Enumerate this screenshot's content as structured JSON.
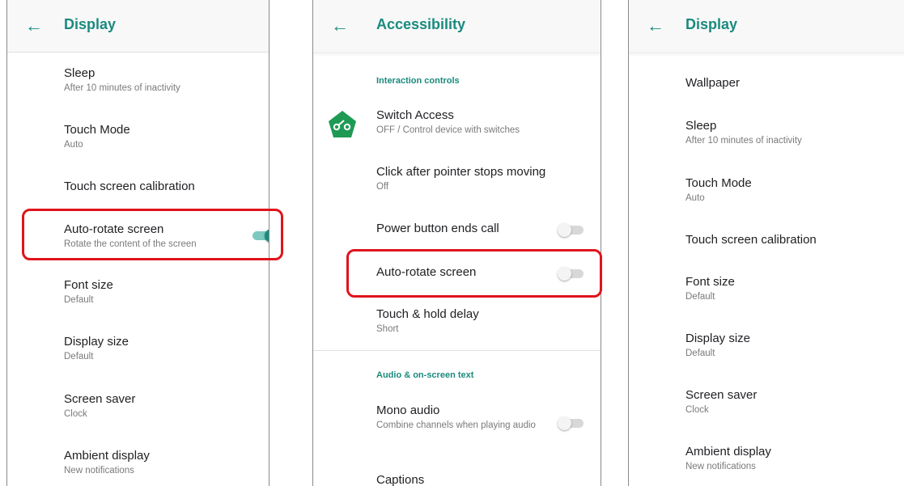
{
  "screens": [
    {
      "title": "Display",
      "items": [
        {
          "title": "Sleep",
          "summary": "After 10 minutes of inactivity"
        },
        {
          "title": "Touch Mode",
          "summary": "Auto"
        },
        {
          "title": "Touch screen calibration",
          "summary": ""
        },
        {
          "title": "Auto-rotate screen",
          "summary": "Rotate the content of the screen",
          "toggle": "on"
        },
        {
          "title": "Font size",
          "summary": "Default"
        },
        {
          "title": "Display size",
          "summary": "Default"
        },
        {
          "title": "Screen saver",
          "summary": "Clock"
        },
        {
          "title": "Ambient display",
          "summary": "New notifications"
        }
      ]
    },
    {
      "title": "Accessibility",
      "section1": "Interaction controls",
      "section2": "Audio & on-screen text",
      "items": [
        {
          "title": "Switch Access",
          "summary": "OFF / Control device with switches",
          "icon": "switch-access-icon"
        },
        {
          "title": "Click after pointer stops moving",
          "summary": "Off"
        },
        {
          "title": "Power button ends call",
          "summary": "",
          "toggle": "off"
        },
        {
          "title": "Auto-rotate screen",
          "summary": "",
          "toggle": "off"
        },
        {
          "title": "Touch & hold delay",
          "summary": "Short"
        },
        {
          "title": "Mono audio",
          "summary": "Combine channels when playing audio",
          "toggle": "off"
        },
        {
          "title": "Captions",
          "summary": ""
        }
      ]
    },
    {
      "title": "Display",
      "items": [
        {
          "title": "Wallpaper",
          "summary": ""
        },
        {
          "title": "Sleep",
          "summary": "After 10 minutes of inactivity"
        },
        {
          "title": "Touch Mode",
          "summary": "Auto"
        },
        {
          "title": "Touch screen calibration",
          "summary": ""
        },
        {
          "title": "Font size",
          "summary": "Default"
        },
        {
          "title": "Display size",
          "summary": "Default"
        },
        {
          "title": "Screen saver",
          "summary": "Clock"
        },
        {
          "title": "Ambient display",
          "summary": "New notifications"
        }
      ]
    }
  ],
  "icons": {
    "back": "back-arrow-icon"
  },
  "colors": {
    "accent": "#1a8a7e",
    "highlight": "#e0141c"
  }
}
